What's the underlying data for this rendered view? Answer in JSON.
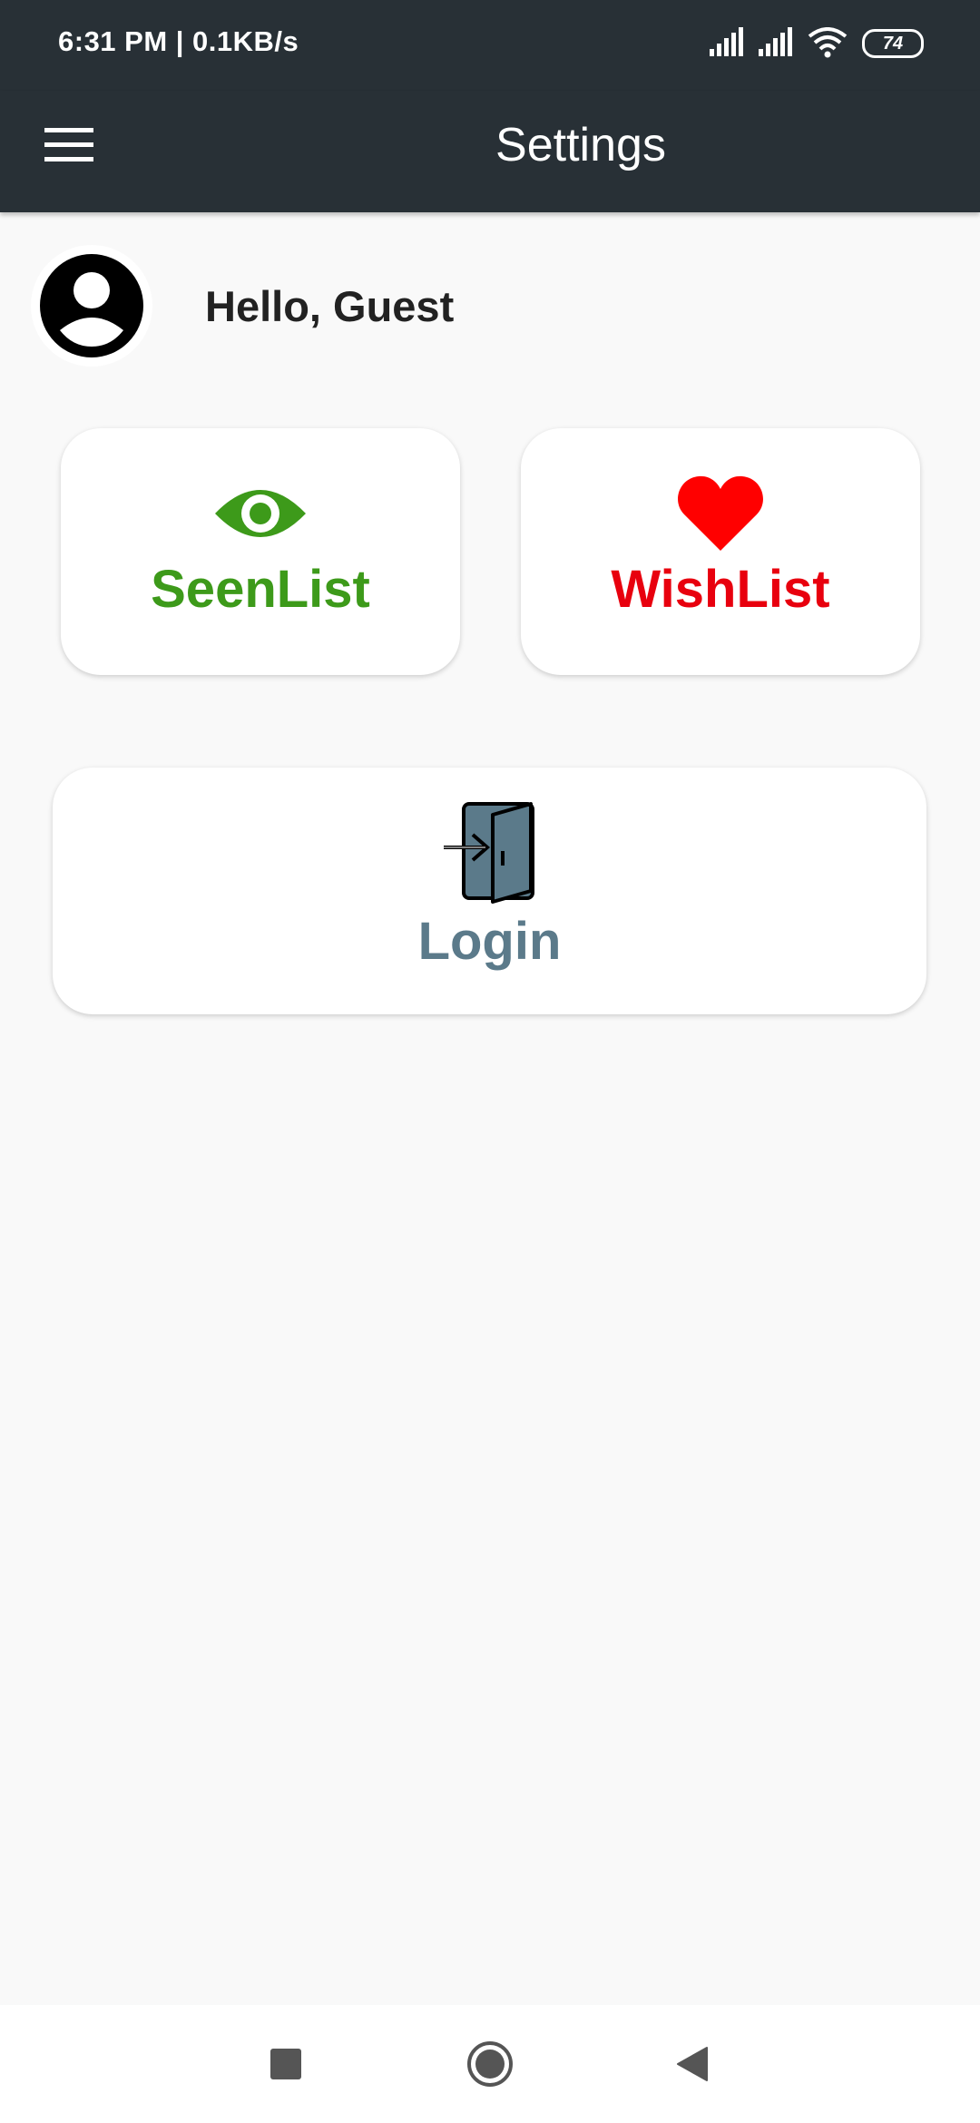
{
  "status_bar": {
    "time_speed": "6:31 PM | 0.1KB/s",
    "battery": "74",
    "icons": [
      "signal-icon",
      "signal-icon",
      "wifi-icon",
      "battery-icon"
    ]
  },
  "app_bar": {
    "title": "Settings",
    "menu_icon": "hamburger-menu-icon"
  },
  "profile": {
    "greeting": "Hello, Guest",
    "avatar_icon": "account-circle-icon"
  },
  "cards": {
    "seenlist": {
      "label": "SeenList",
      "icon": "eye-icon",
      "color": "#3d9a1a"
    },
    "wishlist": {
      "label": "WishList",
      "icon": "heart-icon",
      "color": "#e8000e"
    },
    "login": {
      "label": "Login",
      "icon": "login-door-icon",
      "color": "#5b7a8a"
    }
  },
  "nav_bar": {
    "buttons": [
      "recents-square-icon",
      "home-circle-icon",
      "back-triangle-icon"
    ]
  },
  "colors": {
    "app_bar": "#283036",
    "background": "#f9f9f9"
  }
}
